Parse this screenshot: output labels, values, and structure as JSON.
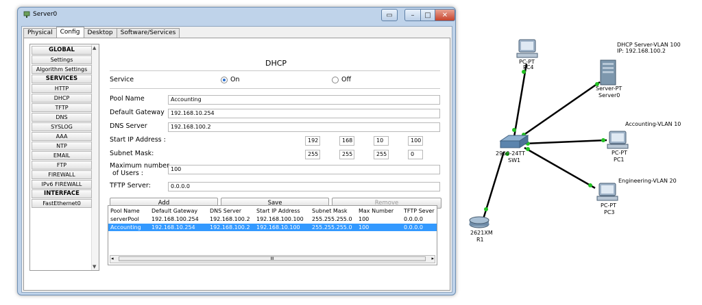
{
  "window": {
    "title": "Server0"
  },
  "tabs": [
    "Physical",
    "Config",
    "Desktop",
    "Software/Services"
  ],
  "active_tab": "Config",
  "left_list": {
    "items": [
      {
        "label": "GLOBAL",
        "header": true
      },
      {
        "label": "Settings",
        "header": false
      },
      {
        "label": "Algorithm Settings",
        "header": false
      },
      {
        "label": "SERVICES",
        "header": true
      },
      {
        "label": "HTTP",
        "header": false
      },
      {
        "label": "DHCP",
        "header": false
      },
      {
        "label": "TFTP",
        "header": false
      },
      {
        "label": "DNS",
        "header": false
      },
      {
        "label": "SYSLOG",
        "header": false
      },
      {
        "label": "AAA",
        "header": false
      },
      {
        "label": "NTP",
        "header": false
      },
      {
        "label": "EMAIL",
        "header": false
      },
      {
        "label": "FTP",
        "header": false
      },
      {
        "label": "FIREWALL",
        "header": false
      },
      {
        "label": "IPv6 FIREWALL",
        "header": false
      },
      {
        "label": "INTERFACE",
        "header": true
      },
      {
        "label": "FastEthernet0",
        "header": false
      }
    ]
  },
  "dhcp": {
    "title": "DHCP",
    "service_label": "Service",
    "on_label": "On",
    "off_label": "Off",
    "service_state": "On",
    "pool_name_label": "Pool Name",
    "pool_name": "Accounting",
    "gateway_label": "Default Gateway",
    "gateway": "192.168.10.254",
    "dns_label": "DNS Server",
    "dns": "192.168.100.2",
    "start_ip_label": "Start IP Address :",
    "start_ip": [
      "192",
      "168",
      "10",
      "100"
    ],
    "mask_label": "Subnet Mask:",
    "mask": [
      "255",
      "255",
      "255",
      "0"
    ],
    "max_users_label_1": "Maximum number",
    "max_users_label_2": "of Users :",
    "max_users": "100",
    "tftp_label": "TFTP Server:",
    "tftp": "0.0.0.0",
    "add_label": "Add",
    "save_label": "Save",
    "remove_label": "Remove"
  },
  "pool_table": {
    "headers": [
      "Pool Name",
      "Default Gateway",
      "DNS Server",
      "Start IP Address",
      "Subnet Mask",
      "Max Number",
      "TFTP Sever"
    ],
    "rows": [
      [
        "serverPool",
        "192.168.100.254",
        "192.168.100.2",
        "192.168.100.100",
        "255.255.255.0",
        "100",
        "0.0.0.0"
      ],
      [
        "Accounting",
        "192.168.10.254",
        "192.168.100.2",
        "192.168.10.100",
        "255.255.255.0",
        "100",
        "0.0.0.0"
      ]
    ],
    "selected_row": 1,
    "scroll_grip": "III"
  },
  "topology": {
    "pc4": {
      "type": "PC-PT",
      "name": "PC4"
    },
    "server": {
      "note1": "DHCP Server-VLAN 100",
      "note2": "IP: 192.168.100.2",
      "type": "Server-PT",
      "name": "Server0"
    },
    "switch": {
      "type": "2960-24TT",
      "name": "SW1"
    },
    "pc1": {
      "note": "Accounting-VLAN 10",
      "type": "PC-PT",
      "name": "PC1"
    },
    "pc3": {
      "note": "Engineering-VLAN 20",
      "type": "PC-PT",
      "name": "PC3"
    },
    "router": {
      "type": "2621XM",
      "name": "R1"
    }
  },
  "colors": {
    "link_up": "#22c022",
    "selection": "#3399ff",
    "close": "#c7432b"
  }
}
